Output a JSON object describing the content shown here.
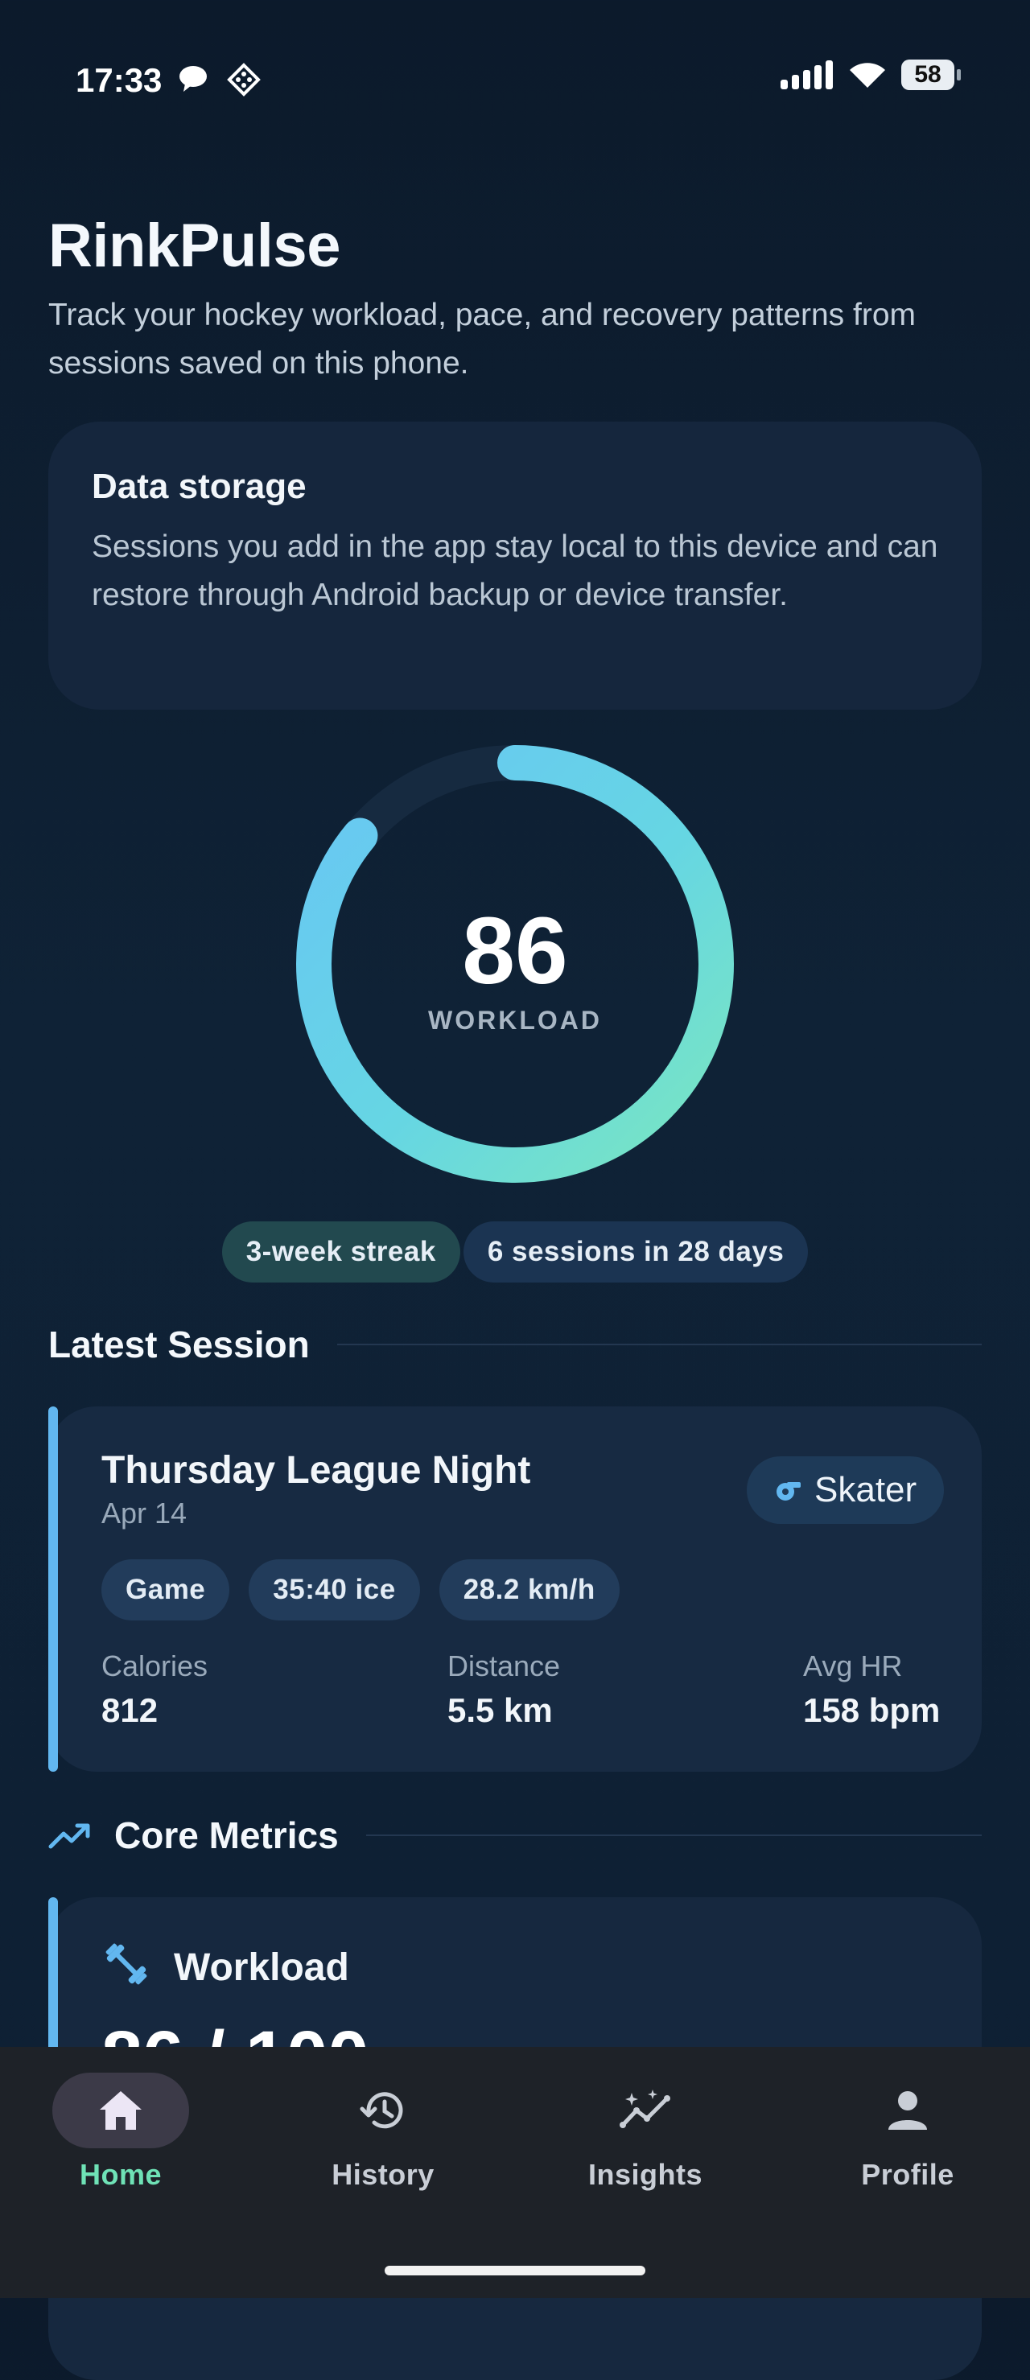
{
  "status_bar": {
    "time": "17:33",
    "battery": "58"
  },
  "header": {
    "title": "RinkPulse",
    "subtitle": "Track your hockey workload, pace, and recovery patterns from sessions saved on this phone."
  },
  "storage_card": {
    "title": "Data storage",
    "body": "Sessions you add in the app stay local to this device and can restore through Android backup or device transfer."
  },
  "workload_ring": {
    "value": "86",
    "label": "WORKLOAD",
    "progress_fraction": 0.86
  },
  "badges": {
    "streak": "3-week streak",
    "sessions": "6 sessions in 28 days"
  },
  "latest_session": {
    "section_title": "Latest Session",
    "name": "Thursday League Night",
    "date": "Apr 14",
    "role": "Skater",
    "tags": [
      "Game",
      "35:40 ice",
      "28.2 km/h"
    ],
    "stats": [
      {
        "label": "Calories",
        "value": "812"
      },
      {
        "label": "Distance",
        "value": "5.5 km"
      },
      {
        "label": "Avg HR",
        "value": "158 bpm"
      }
    ]
  },
  "core_metrics": {
    "section_title": "Core Metrics",
    "workload_title": "Workload",
    "workload_value": "86 / 100"
  },
  "bottom_nav": {
    "items": [
      {
        "label": "Home",
        "icon": "home-icon",
        "active": true
      },
      {
        "label": "History",
        "icon": "history-icon",
        "active": false
      },
      {
        "label": "Insights",
        "icon": "insights-icon",
        "active": false
      },
      {
        "label": "Profile",
        "icon": "profile-icon",
        "active": false
      }
    ]
  },
  "colors": {
    "background": "#0f2236",
    "card": "#172a42",
    "accent_teal": "#6fe2b6",
    "accent_blue": "#62b7f0",
    "nav_background": "#1e2228"
  }
}
